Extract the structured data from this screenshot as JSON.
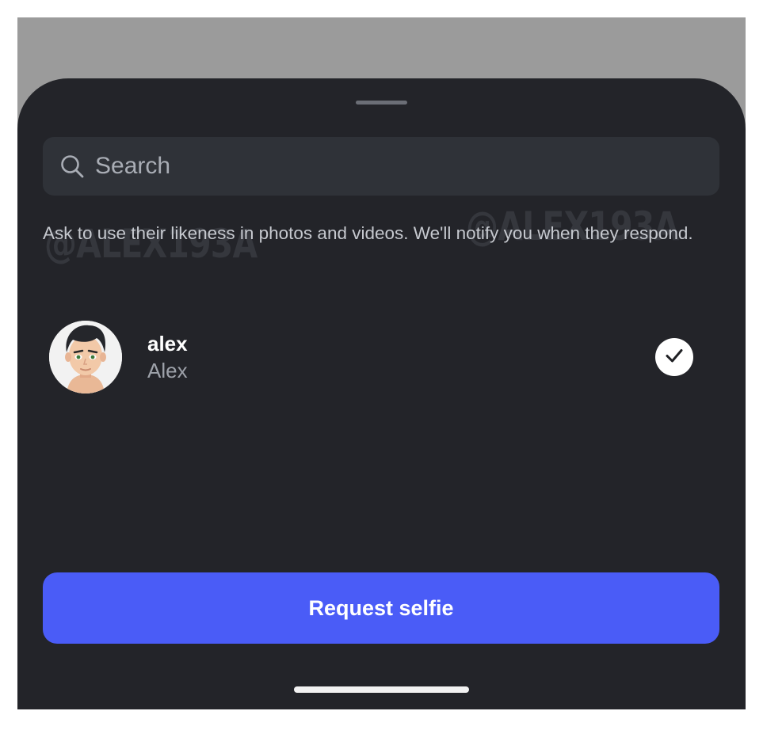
{
  "search": {
    "placeholder": "Search",
    "icon": "search-icon"
  },
  "hint": "Ask to use their likeness in photos and videos. We'll notify you when they respond.",
  "watermark": {
    "text": "@ALEX193A"
  },
  "contact": {
    "username": "alex",
    "display_name": "Alex",
    "selected": true,
    "avatar_icon": "avatar-icon",
    "check_icon": "checkmark-icon"
  },
  "actions": {
    "request_label": "Request selfie"
  },
  "colors": {
    "sheet_background": "#232429",
    "search_background": "#2f3238",
    "accent": "#4a5cf7",
    "backdrop": "#9b9b9b"
  }
}
